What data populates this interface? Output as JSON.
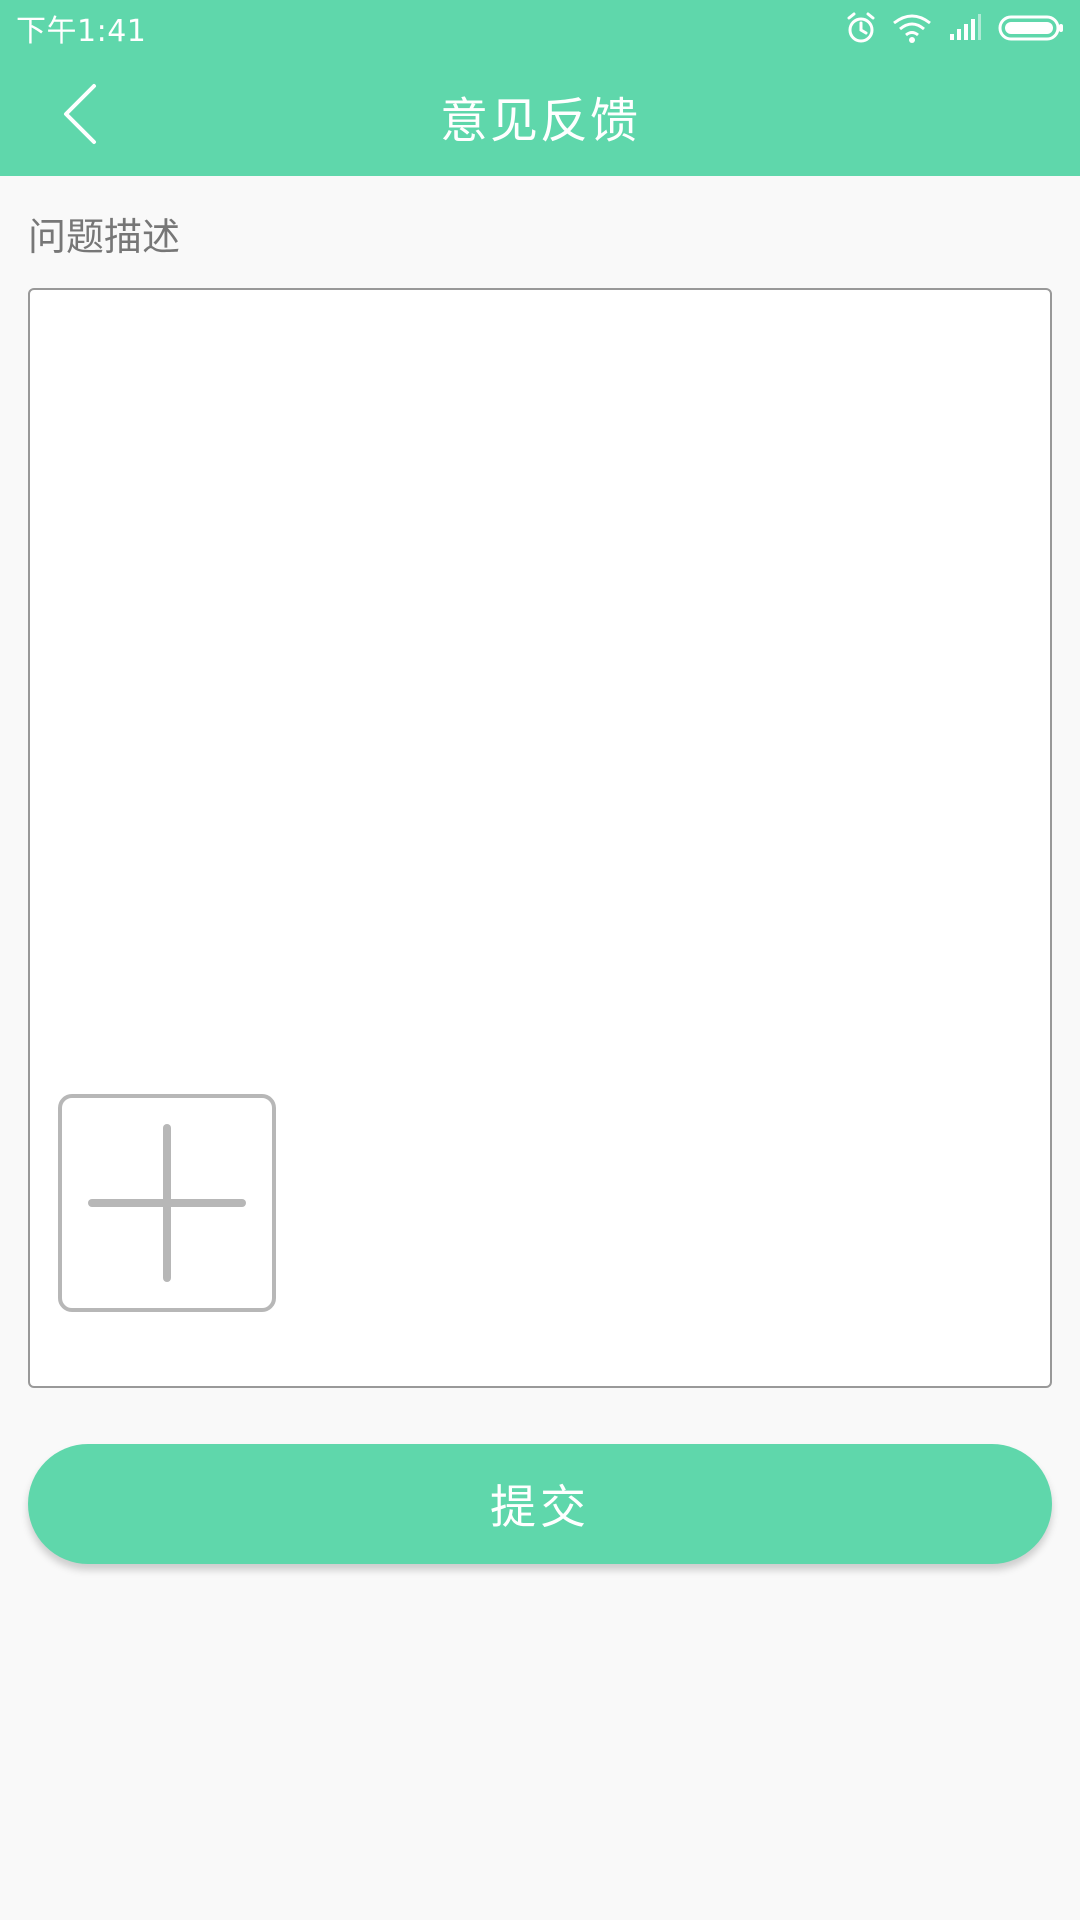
{
  "status_bar": {
    "time": "下午1:41",
    "icons": [
      "alarm-icon",
      "wifi-icon",
      "signal-icon",
      "battery-icon"
    ]
  },
  "app_bar": {
    "title": "意见反馈",
    "back_icon": "chevron-left-icon"
  },
  "form": {
    "section_label": "问题描述",
    "description_value": "",
    "description_placeholder": "",
    "add_image_icon": "plus-icon"
  },
  "submit": {
    "label": "提交"
  },
  "colors": {
    "accent": "#5fd7ab",
    "background": "#f9f9f9",
    "label_text": "#777777",
    "box_border": "#999999",
    "plus_gray": "#b7b7b7"
  }
}
